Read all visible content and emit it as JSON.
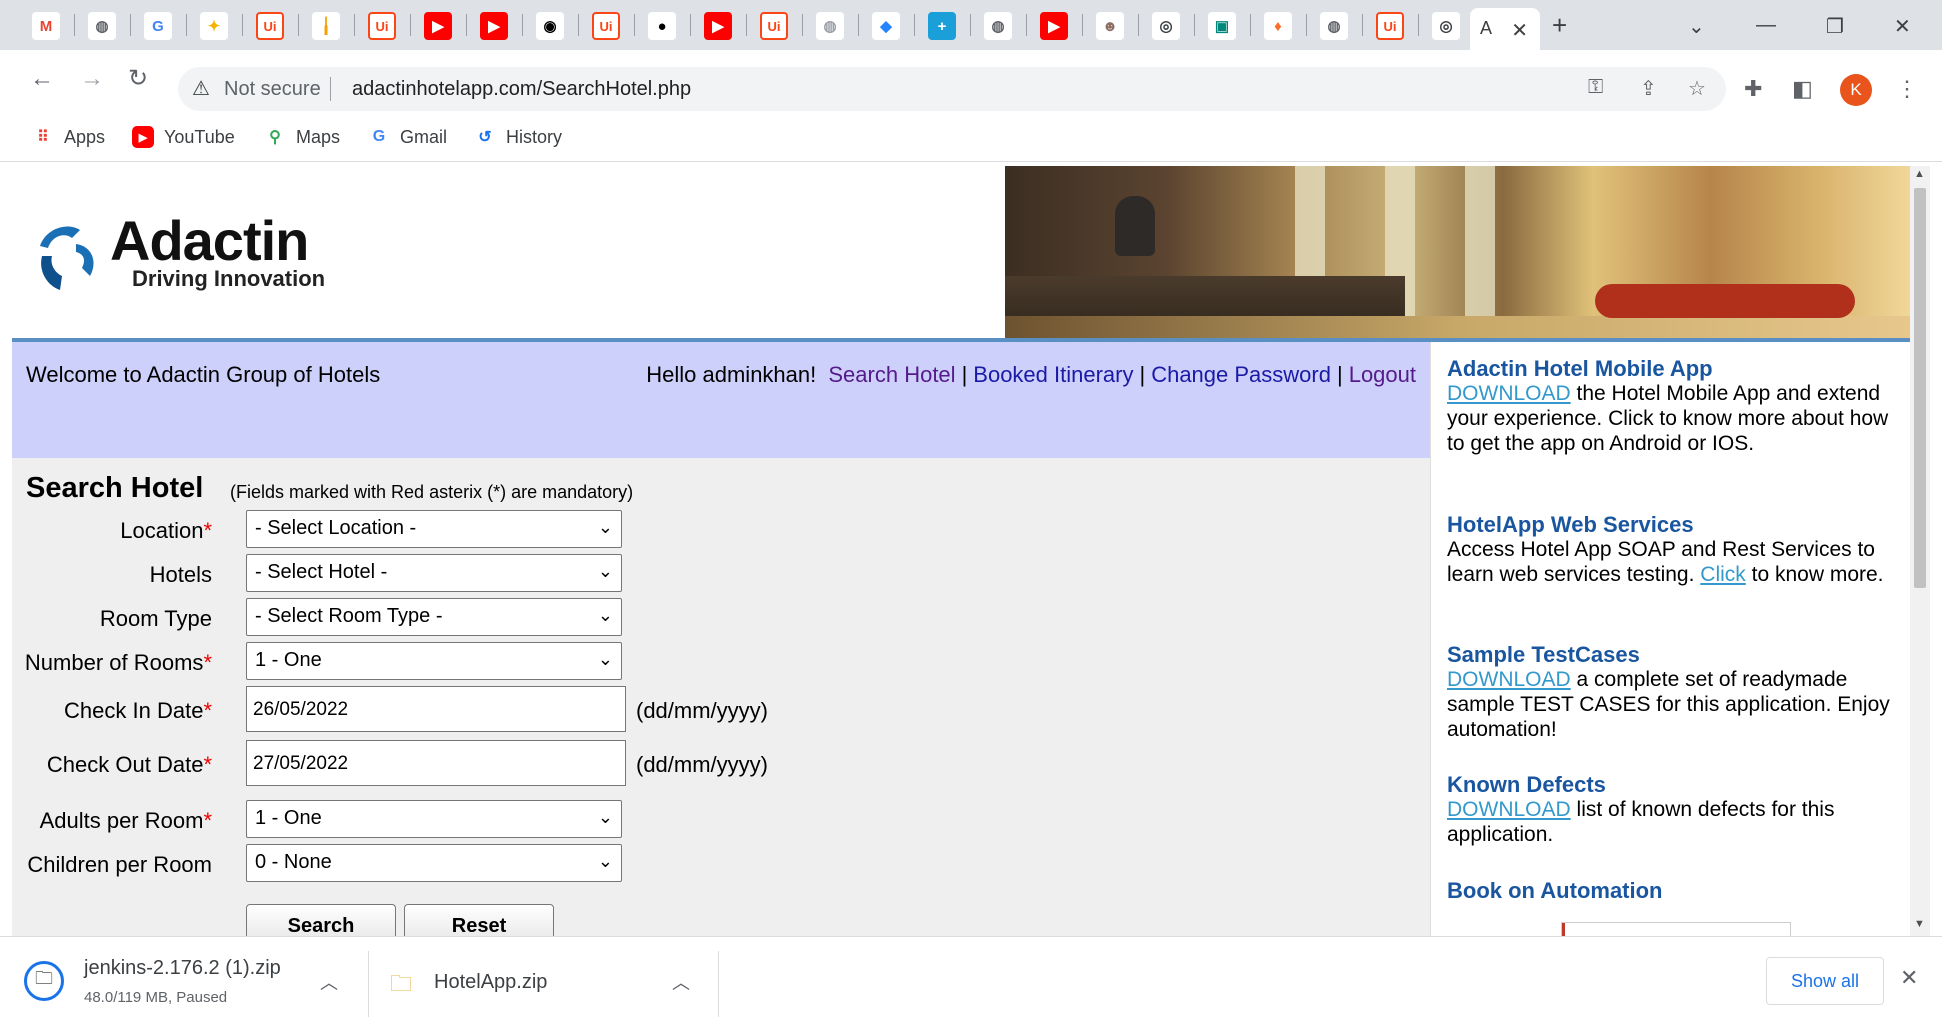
{
  "browser": {
    "tab_icons": [
      {
        "icon": "gmail-icon",
        "glyph": "M",
        "color": "#ea4335",
        "bg": "#ffffff"
      },
      {
        "icon": "globe-icon",
        "glyph": "◍",
        "color": "#5f6368",
        "bg": "#ffffff"
      },
      {
        "icon": "google-icon",
        "glyph": "G",
        "color": "#4285f4",
        "bg": "#ffffff"
      },
      {
        "icon": "feather-icon",
        "glyph": "✦",
        "color": "#f4b400",
        "bg": "#ffffff"
      },
      {
        "icon": "uipath-icon",
        "glyph": "Ui",
        "color": "#fa4616",
        "bg": "#ffffff"
      },
      {
        "icon": "pipes-icon",
        "glyph": "╽",
        "color": "#f4a100",
        "bg": "#ffffff"
      },
      {
        "icon": "uipath-icon",
        "glyph": "Ui",
        "color": "#fa4616",
        "bg": "#ffffff"
      },
      {
        "icon": "youtube-icon",
        "glyph": "▶",
        "color": "#ffffff",
        "bg": "#ff0000"
      },
      {
        "icon": "youtube-icon",
        "glyph": "▶",
        "color": "#ffffff",
        "bg": "#ff0000"
      },
      {
        "icon": "robot-icon",
        "glyph": "◉",
        "color": "#000000",
        "bg": "#ffffff"
      },
      {
        "icon": "uipath-icon",
        "glyph": "Ui",
        "color": "#fa4616",
        "bg": "#ffffff"
      },
      {
        "icon": "github-icon",
        "glyph": "●",
        "color": "#000000",
        "bg": "#ffffff"
      },
      {
        "icon": "youtube-icon",
        "glyph": "▶",
        "color": "#ffffff",
        "bg": "#ff0000"
      },
      {
        "icon": "uipath-icon",
        "glyph": "Ui",
        "color": "#fa4616",
        "bg": "#ffffff"
      },
      {
        "icon": "globe-icon",
        "glyph": "◍",
        "color": "#9aa0a6",
        "bg": "#ffffff"
      },
      {
        "icon": "jira-icon",
        "glyph": "◆",
        "color": "#2684ff",
        "bg": "#ffffff"
      },
      {
        "icon": "plus-app-icon",
        "glyph": "+",
        "color": "#ffffff",
        "bg": "#1a9fd9"
      },
      {
        "icon": "globe-icon",
        "glyph": "◍",
        "color": "#5f6368",
        "bg": "#ffffff"
      },
      {
        "icon": "youtube-icon",
        "glyph": "▶",
        "color": "#ffffff",
        "bg": "#ff0000"
      },
      {
        "icon": "avatar-icon",
        "glyph": "☻",
        "color": "#8d6e63",
        "bg": "#ffffff"
      },
      {
        "icon": "chrome-icon",
        "glyph": "◎",
        "color": "#3c4043",
        "bg": "#ffffff"
      },
      {
        "icon": "meet-icon",
        "glyph": "▣",
        "color": "#00897b",
        "bg": "#ffffff"
      },
      {
        "icon": "gitlab-icon",
        "glyph": "♦",
        "color": "#fc6d26",
        "bg": "#ffffff"
      },
      {
        "icon": "globe-icon",
        "glyph": "◍",
        "color": "#5f6368",
        "bg": "#ffffff"
      },
      {
        "icon": "uipath-icon",
        "glyph": "Ui",
        "color": "#fa4616",
        "bg": "#ffffff"
      },
      {
        "icon": "chrome-icon",
        "glyph": "◎",
        "color": "#3c4043",
        "bg": "#ffffff"
      }
    ],
    "active_tab_text": "A",
    "omnibox": {
      "security_label": "Not secure",
      "url": "adactinhotelapp.com/SearchHotel.php"
    },
    "profile_initial": "K",
    "bookmarks": [
      {
        "label": "Apps",
        "icon": "apps-grid-icon"
      },
      {
        "label": "YouTube",
        "icon": "youtube-icon"
      },
      {
        "label": "Maps",
        "icon": "maps-pin-icon"
      },
      {
        "label": "Gmail",
        "icon": "google-icon"
      },
      {
        "label": "History",
        "icon": "history-icon"
      }
    ]
  },
  "site": {
    "logo_title": "Adactin",
    "logo_subtitle": "Driving Innovation",
    "welcome": "Welcome to Adactin Group of Hotels",
    "greeting": "Hello adminkhan!",
    "nav": {
      "search_hotel": "Search Hotel",
      "booked_itinerary": "Booked Itinerary",
      "change_password": "Change Password",
      "logout": "Logout",
      "separator": "|"
    },
    "form": {
      "title": "Search Hotel",
      "note": "(Fields marked with Red asterix (*) are mandatory)",
      "required_mark": "*",
      "location_label": "Location",
      "location_value": "- Select Location -",
      "hotels_label": "Hotels",
      "hotels_value": "- Select Hotel -",
      "room_type_label": "Room Type",
      "room_type_value": "- Select Room Type -",
      "rooms_label": "Number of Rooms",
      "rooms_value": "1 - One",
      "checkin_label": "Check In Date",
      "checkin_value": "26/05/2022",
      "checkout_label": "Check Out Date",
      "checkout_value": "27/05/2022",
      "date_format": "(dd/mm/yyyy)",
      "adults_label": "Adults per Room",
      "adults_value": "1 - One",
      "children_label": "Children per Room",
      "children_value": "0 - None",
      "search_button": "Search",
      "reset_button": "Reset"
    },
    "sidebar": {
      "mobile_title": "Adactin Hotel Mobile App",
      "mobile_link": "DOWNLOAD",
      "mobile_text": " the Hotel Mobile App and extend your experience. Click to know more about how to get the app on Android or IOS.",
      "ws_title": "HotelApp Web Services",
      "ws_text_1": "Access Hotel App SOAP and Rest Services to learn web services testing. ",
      "ws_link": "Click",
      "ws_text_2": " to know more.",
      "tc_title": "Sample TestCases",
      "tc_link": "DOWNLOAD",
      "tc_text": " a complete set of readymade sample TEST CASES for this application. Enjoy automation!",
      "kd_title": "Known Defects",
      "kd_link": "DOWNLOAD",
      "kd_text": " list of known defects for this application.",
      "book_title": "Book on Automation"
    }
  },
  "downloads": {
    "items": [
      {
        "name": "jenkins-2.176.2 (1).zip",
        "status": "48.0/119 MB, Paused"
      },
      {
        "name": "HotelApp.zip",
        "status": ""
      }
    ],
    "show_all": "Show all"
  },
  "colors": {
    "nav_band": "#cdd0fb",
    "content_bg": "#efefef",
    "sidebar_heading": "#1a56a0",
    "sidebar_link": "#3399cc",
    "required": "#ee0000"
  }
}
